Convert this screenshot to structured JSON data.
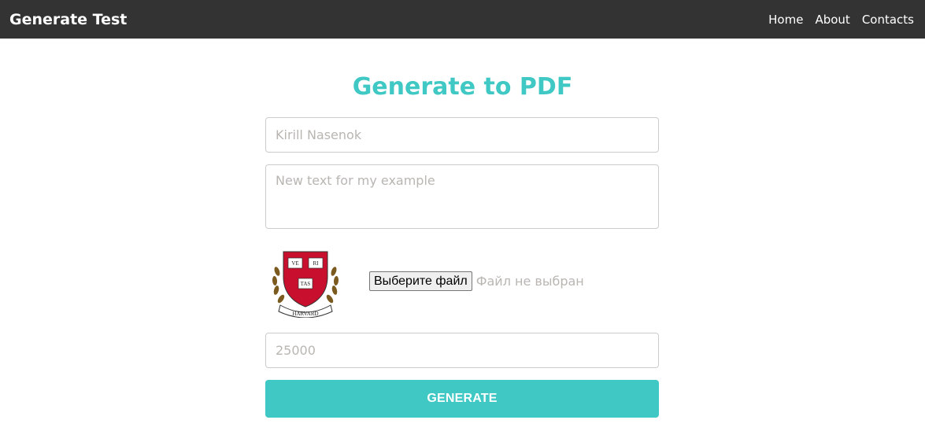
{
  "navbar": {
    "brand": "Generate Test",
    "links": [
      "Home",
      "About",
      "Contacts"
    ]
  },
  "main": {
    "title": "Generate to PDF",
    "name_placeholder": "Kirill Nasenok",
    "text_placeholder": "New text for my example",
    "file_button_label": "Выберите файл",
    "file_status": "Файл не выбран",
    "amount_placeholder": "25000",
    "generate_label": "GENERATE"
  },
  "logo": {
    "shield_words": [
      "VE",
      "RI",
      "TAS"
    ],
    "banner_text": "HARVARD"
  },
  "colors": {
    "navbar_bg": "#333333",
    "accent": "#40c8c4",
    "placeholder": "#b9b6b2",
    "shield_red": "#c8102e"
  }
}
